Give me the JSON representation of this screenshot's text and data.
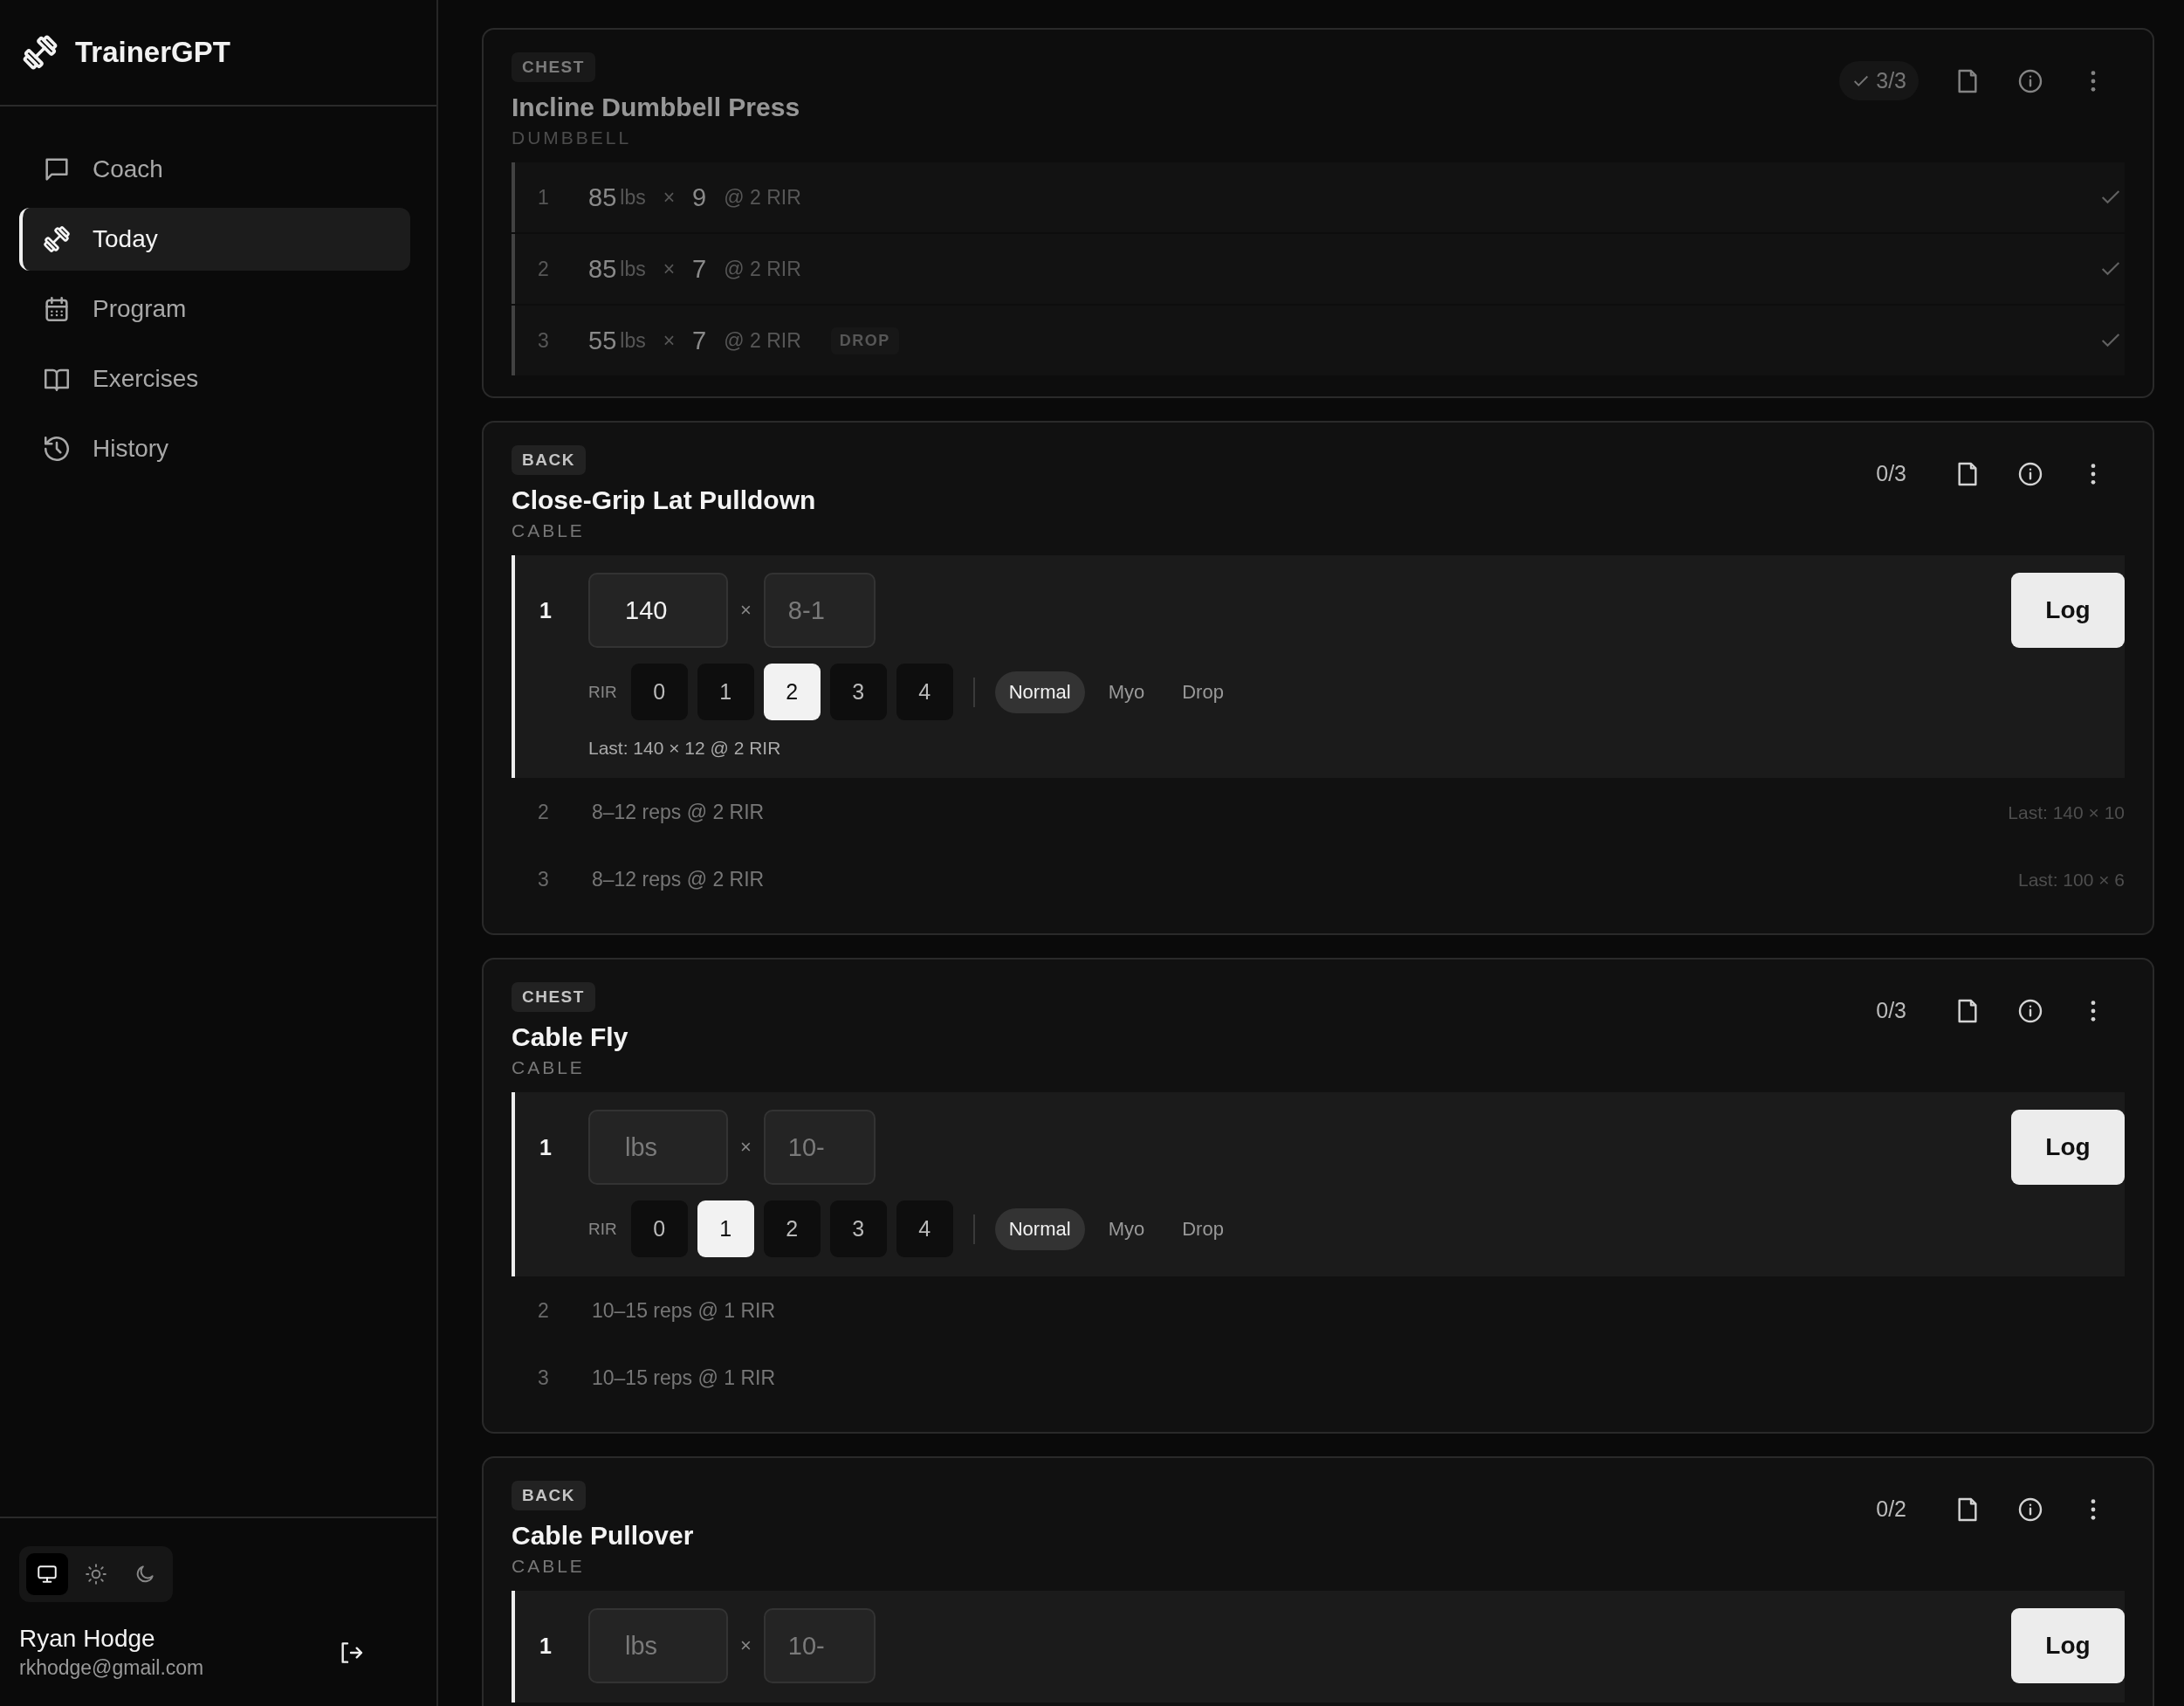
{
  "sidebar": {
    "brand": "TrainerGPT",
    "nav": [
      {
        "label": "Coach",
        "selected": false
      },
      {
        "label": "Today",
        "selected": true
      },
      {
        "label": "Program",
        "selected": false
      },
      {
        "label": "Exercises",
        "selected": false
      },
      {
        "label": "History",
        "selected": false
      }
    ],
    "theme_options": [
      {
        "selected": true
      },
      {
        "selected": false
      },
      {
        "selected": false
      }
    ],
    "user": {
      "name": "Ryan Hodge",
      "email": "rkhodge@gmail.com"
    }
  },
  "exercises": [
    {
      "muscle": "CHEST",
      "name": "Incline Dumbbell Press",
      "equipment": "DUMBBELL",
      "progress": "3/3",
      "completed": true,
      "sets": [
        {
          "kind": "done",
          "number": "1",
          "weight": "85",
          "unit": "lbs",
          "separator": "×",
          "reps": "9",
          "rir": "@ 2 RIR"
        },
        {
          "kind": "done",
          "number": "2",
          "weight": "85",
          "unit": "lbs",
          "separator": "×",
          "reps": "7",
          "rir": "@ 2 RIR"
        },
        {
          "kind": "done",
          "number": "3",
          "weight": "55",
          "unit": "lbs",
          "separator": "×",
          "reps": "7",
          "rir": "@ 2 RIR",
          "tag": "DROP"
        }
      ]
    },
    {
      "muscle": "BACK",
      "name": "Close-Grip Lat Pulldown",
      "equipment": "CABLE",
      "progress": "0/3",
      "completed": false,
      "sets": [
        {
          "kind": "active",
          "number": "1",
          "weight": {
            "value": "140"
          },
          "separator": "×",
          "reps": {
            "placeholder": "8-1"
          },
          "button": "Log",
          "rir_label": "RIR",
          "rir_options": [
            {
              "label": "0",
              "selected": false
            },
            {
              "label": "1",
              "selected": false
            },
            {
              "label": "2",
              "selected": true
            },
            {
              "label": "3",
              "selected": false
            },
            {
              "label": "4",
              "selected": false
            }
          ],
          "types": [
            {
              "label": "Normal",
              "selected": true
            },
            {
              "label": "Myo",
              "selected": false
            },
            {
              "label": "Drop",
              "selected": false
            }
          ],
          "last": "Last: 140 × 12 @ 2 RIR"
        },
        {
          "kind": "pending",
          "number": "2",
          "target": "8–12 reps @ 2 RIR",
          "last": "Last: 140 × 10"
        },
        {
          "kind": "pending",
          "number": "3",
          "target": "8–12 reps @ 2 RIR",
          "last": "Last: 100 × 6"
        }
      ]
    },
    {
      "muscle": "CHEST",
      "name": "Cable Fly",
      "equipment": "CABLE",
      "progress": "0/3",
      "completed": false,
      "sets": [
        {
          "kind": "active",
          "number": "1",
          "weight": {
            "placeholder": "lbs"
          },
          "separator": "×",
          "reps": {
            "placeholder": "10-"
          },
          "button": "Log",
          "rir_label": "RIR",
          "rir_options": [
            {
              "label": "0",
              "selected": false
            },
            {
              "label": "1",
              "selected": true
            },
            {
              "label": "2",
              "selected": false
            },
            {
              "label": "3",
              "selected": false
            },
            {
              "label": "4",
              "selected": false
            }
          ],
          "types": [
            {
              "label": "Normal",
              "selected": true
            },
            {
              "label": "Myo",
              "selected": false
            },
            {
              "label": "Drop",
              "selected": false
            }
          ]
        },
        {
          "kind": "pending",
          "number": "2",
          "target": "10–15 reps @ 1 RIR"
        },
        {
          "kind": "pending",
          "number": "3",
          "target": "10–15 reps @ 1 RIR"
        }
      ]
    },
    {
      "muscle": "BACK",
      "name": "Cable Pullover",
      "equipment": "CABLE",
      "progress": "0/2",
      "completed": false,
      "sets": [
        {
          "kind": "active",
          "number": "1",
          "weight": {
            "placeholder": "lbs"
          },
          "separator": "×",
          "reps": {
            "placeholder": "10-"
          },
          "button": "Log"
        }
      ]
    }
  ]
}
